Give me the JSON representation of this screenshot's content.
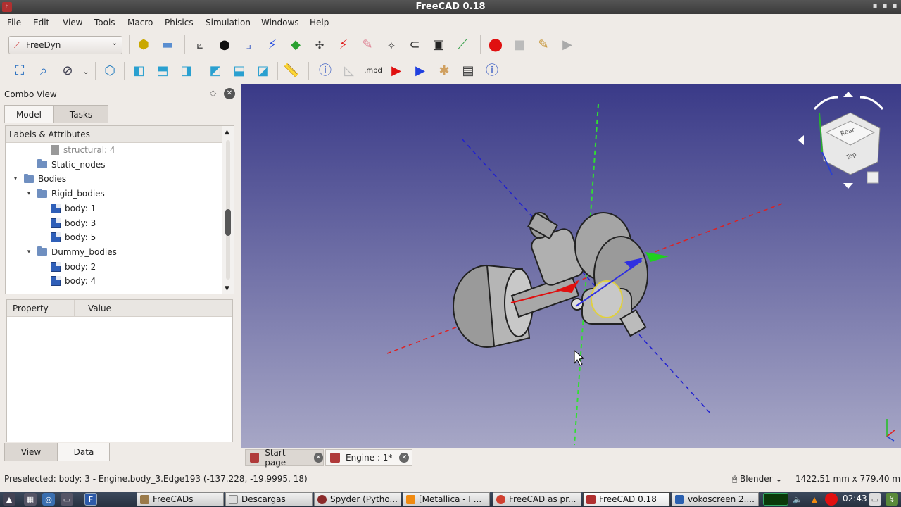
{
  "window": {
    "title": "FreeCAD 0.18",
    "close_glyph": "▪",
    "min_glyph": "▪",
    "max_glyph": "▪"
  },
  "menu": [
    "File",
    "Edit",
    "View",
    "Tools",
    "Macro",
    "Phisics",
    "Simulation",
    "Windows",
    "Help"
  ],
  "toolbar": {
    "workbench": "FreeDyn",
    "mbd_label": ".mbd"
  },
  "combo": {
    "title": "Combo View",
    "tabs": {
      "model": "Model",
      "tasks": "Tasks"
    },
    "tree_header": "Labels & Attributes",
    "tree": [
      {
        "label": "structural: 4",
        "indent": 3,
        "icon": "struct",
        "twisty": "",
        "dim": true
      },
      {
        "label": "Static_nodes",
        "indent": 2,
        "icon": "folder",
        "twisty": ""
      },
      {
        "label": "Bodies",
        "indent": 1,
        "icon": "folder",
        "twisty": "▾"
      },
      {
        "label": "Rigid_bodies",
        "indent": 2,
        "icon": "folder",
        "twisty": "▾"
      },
      {
        "label": "body: 1",
        "indent": 3,
        "icon": "body",
        "twisty": ""
      },
      {
        "label": "body: 3",
        "indent": 3,
        "icon": "body",
        "twisty": ""
      },
      {
        "label": "body: 5",
        "indent": 3,
        "icon": "body",
        "twisty": ""
      },
      {
        "label": "Dummy_bodies",
        "indent": 2,
        "icon": "folder",
        "twisty": "▾"
      },
      {
        "label": "body: 2",
        "indent": 3,
        "icon": "body",
        "twisty": ""
      },
      {
        "label": "body: 4",
        "indent": 3,
        "icon": "body",
        "twisty": ""
      }
    ],
    "property": {
      "col1": "Property",
      "col2": "Value"
    },
    "bottom_tabs": {
      "view": "View",
      "data": "Data"
    }
  },
  "navcube": {
    "face_rear": "Rear",
    "face_top": "Top"
  },
  "doc_tabs": [
    {
      "label": "Start page"
    },
    {
      "label": "Engine : 1*"
    }
  ],
  "status": {
    "message": "Preselected: body: 3 - Engine.body_3.Edge193 (-137.228, -19.9995, 18)",
    "navigation": "Blender",
    "dimensions": "1422.51 mm x 779.40 mr"
  },
  "taskbar": {
    "buttons": [
      "FreeCADs",
      "Descargas",
      "Spyder (Pytho...",
      "[Metallica - I ...",
      "FreeCAD as pr...",
      "FreeCAD 0.18",
      "vokoscreen 2...."
    ],
    "clock": "02:43"
  },
  "colors": {
    "viewport_top": "#3a3a88",
    "viewport_bottom": "#a7a7c6",
    "axis_x": "#e02020",
    "axis_y": "#20d020",
    "axis_z": "#2020d0",
    "record_red": "#e01010"
  },
  "icons": [
    "part-icon",
    "open-folder-icon",
    "axes-icon",
    "apple-body-icon",
    "node-icon",
    "lightning-icon",
    "green-joint-icon",
    "red-lightning-icon",
    "pink-link-icon",
    "graph-icon",
    "clamp-icon",
    "motor-icon",
    "wand-icon",
    "record-icon",
    "stop-icon",
    "edit-macro-icon",
    "play-macro-icon"
  ]
}
